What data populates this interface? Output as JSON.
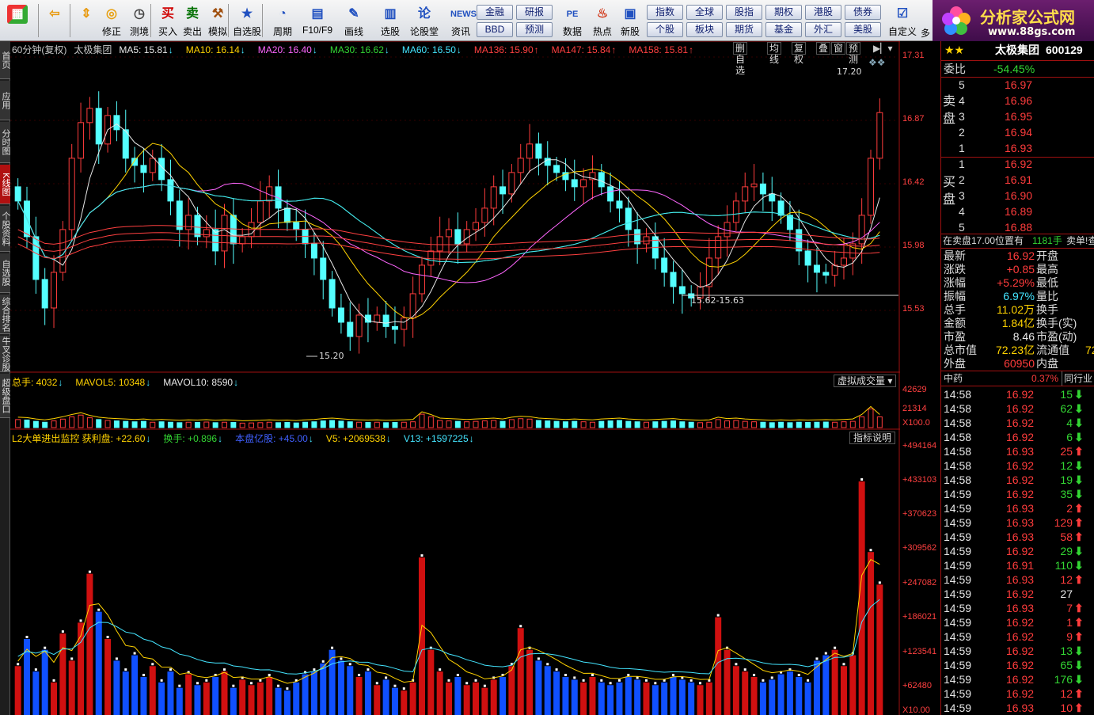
{
  "toolbar": {
    "items": [
      {
        "label": "",
        "icon": "grid-icon",
        "color": "#d03030"
      },
      {
        "label": "",
        "icon": "back-icon",
        "color": "#e89a10"
      },
      {
        "label": "",
        "icon": "updown-icon",
        "color": "#e89a10"
      },
      {
        "label": "修正",
        "icon": "refresh-icon",
        "color": "#e8a010"
      },
      {
        "label": "测境",
        "icon": "clock-icon",
        "color": "#444"
      },
      {
        "label": "买入",
        "icon": "买",
        "color": "#d00000"
      },
      {
        "label": "卖出",
        "icon": "卖",
        "color": "#007000"
      },
      {
        "label": "模拟",
        "icon": "hammer-icon",
        "color": "#a05010"
      },
      {
        "label": "自选股",
        "icon": "star-icon",
        "color": "#2050c0"
      },
      {
        "label": "周期",
        "icon": "cycle-icon",
        "color": "#2050c0"
      },
      {
        "label": "F10/F9",
        "icon": "f10-icon",
        "color": "#2050c0"
      },
      {
        "label": "画线",
        "icon": "pencil-icon",
        "color": "#2050c0"
      },
      {
        "label": "选股",
        "icon": "chart-icon",
        "color": "#2050c0"
      },
      {
        "label": "论股堂",
        "icon": "论",
        "color": "#2050c0"
      },
      {
        "label": "资讯",
        "icon": "NEWS",
        "color": "#2050c0"
      }
    ],
    "grid_a": [
      [
        "金融",
        "研报"
      ],
      [
        "BBD",
        "预测"
      ]
    ],
    "items2": [
      {
        "label": "数据",
        "icon": "PE",
        "color": "#2050c0"
      },
      {
        "label": "热点",
        "icon": "fire-icon",
        "color": "#d03010"
      },
      {
        "label": "新股",
        "icon": "doc-icon",
        "color": "#2050c0"
      }
    ],
    "grid_b": [
      [
        "指数",
        "全球",
        "股指",
        "期权",
        "港股",
        "债券"
      ],
      [
        "个股",
        "板块",
        "期货",
        "基金",
        "外汇",
        "美股"
      ]
    ],
    "custom_label": "自定义",
    "more_label": "多"
  },
  "logo": {
    "title": "分析家公式网",
    "url": "www.88gs.com"
  },
  "left_tabs": [
    {
      "label": "首页",
      "sel": false
    },
    {
      "label": "应用",
      "sel": false
    },
    {
      "label": "分时图",
      "sel": false
    },
    {
      "label": "K线图",
      "sel": true
    },
    {
      "label": "个股资料",
      "sel": false
    },
    {
      "label": "自选股",
      "sel": false
    },
    {
      "label": "综合排名",
      "sel": false
    },
    {
      "label": "牛叉诊股",
      "sel": false
    },
    {
      "label": "超级盘口",
      "sel": false
    }
  ],
  "kline": {
    "legend": [
      {
        "text": "60分钟(复权)",
        "color": "#c8c8c8"
      },
      {
        "text": "太极集团",
        "color": "#c8c8c8"
      },
      {
        "text": "MA5: 15.81",
        "arrow": "↓",
        "color": "#e8e8e8",
        "acolor": "#44e5ff"
      },
      {
        "text": "MA10: 16.14",
        "arrow": "↓",
        "color": "#ffd200",
        "acolor": "#44e5ff"
      },
      {
        "text": "MA20: 16.40",
        "arrow": "↓",
        "color": "#ff66ff",
        "acolor": "#44e5ff"
      },
      {
        "text": "MA30: 16.62",
        "arrow": "↓",
        "color": "#33d633",
        "acolor": "#44e5ff"
      },
      {
        "text": "MA60: 16.50",
        "arrow": "↓",
        "color": "#44e5ff",
        "acolor": "#44e5ff"
      },
      {
        "text": "MA136: 15.90",
        "arrow": "↑",
        "color": "#ff4040",
        "acolor": "#ff4040"
      },
      {
        "text": "MA147: 15.84",
        "arrow": "↑",
        "color": "#ff4040",
        "acolor": "#ff4040"
      },
      {
        "text": "MA158: 15.81",
        "arrow": "↑",
        "color": "#ff4040",
        "acolor": "#ff4040"
      }
    ],
    "option_buttons": [
      "删自选",
      "均线",
      "复权",
      "叠",
      "窗",
      "预测"
    ],
    "y_ticks": [
      "17.31",
      "16.87",
      "16.42",
      "15.98",
      "15.53"
    ],
    "high_label": "17.20",
    "low_label": "15.20",
    "range_label": "15.62-15.63"
  },
  "volume": {
    "legend": [
      {
        "text": "总手: 4032",
        "arrow": "↓",
        "color": "#ffd200"
      },
      {
        "text": "MAVOL5: 10348",
        "arrow": "↓",
        "color": "#ffd200"
      },
      {
        "text": "MAVOL10: 8590",
        "arrow": "↓",
        "color": "#e8e8e8"
      }
    ],
    "menu": "虚拟成交量",
    "y_ticks": [
      "42629",
      "21314",
      "X100.0"
    ]
  },
  "indicator": {
    "legend": [
      {
        "text": "L2大单进出监控 获利盘: +22.60",
        "arrow": "↓",
        "color": "#ffd200"
      },
      {
        "text": "换手: +0.896",
        "arrow": "↓",
        "color": "#33d633"
      },
      {
        "text": "本盘亿股: +45.00",
        "arrow": "↓",
        "color": "#4060ff"
      },
      {
        "text": "V5: +2069538",
        "arrow": "↓",
        "color": "#ffd200"
      },
      {
        "text": "V13: +1597225",
        "arrow": "↓",
        "color": "#44e5ff"
      }
    ],
    "help": "指标说明",
    "y_ticks": [
      "+494164",
      "+433103",
      "+370623",
      "+309562",
      "+247082",
      "+186021",
      "+123541",
      "+62480",
      "X10.00"
    ]
  },
  "right_panel": {
    "stars": "★★",
    "stock_name": "太极集团",
    "stock_code": "600129",
    "weibi_label": "委比",
    "weibi_value": "-54.45%",
    "sell_label": "卖盘",
    "buy_label": "买盘",
    "asks": [
      {
        "n": "5",
        "p": "16.97"
      },
      {
        "n": "4",
        "p": "16.96"
      },
      {
        "n": "3",
        "p": "16.95"
      },
      {
        "n": "2",
        "p": "16.94"
      },
      {
        "n": "1",
        "p": "16.93"
      }
    ],
    "bids": [
      {
        "n": "1",
        "p": "16.92"
      },
      {
        "n": "2",
        "p": "16.91"
      },
      {
        "n": "3",
        "p": "16.90"
      },
      {
        "n": "4",
        "p": "16.89"
      },
      {
        "n": "5",
        "p": "16.88"
      }
    ],
    "order_info": "在卖盘17.00位置有",
    "order_qty": "1181手",
    "order_more": "卖单!查",
    "stats": [
      {
        "l": "最新",
        "v": "16.92",
        "c": "red",
        "r": "开盘"
      },
      {
        "l": "涨跌",
        "v": "+0.85",
        "c": "red",
        "r": "最高"
      },
      {
        "l": "涨幅",
        "v": "+5.29%",
        "c": "red",
        "r": "最低"
      },
      {
        "l": "振幅",
        "v": "6.97%",
        "c": "cyan",
        "r": "量比"
      },
      {
        "l": "总手",
        "v": "11.02万",
        "c": "yel",
        "r": "换手"
      },
      {
        "l": "金额",
        "v": "1.84亿",
        "c": "yel",
        "r": "换手(实)"
      },
      {
        "l": "市盈",
        "v": "8.46",
        "c": "wht",
        "r": "市盈(动)"
      },
      {
        "l": "总市值",
        "v": "72.23亿",
        "c": "yel",
        "r": "流通值"
      },
      {
        "l": "外盘",
        "v": "60950",
        "c": "red",
        "r": "内盘"
      }
    ],
    "turnover_float": "72",
    "sector": "中药",
    "sector_change": "0.37%",
    "sector_more": "同行业",
    "ticks": [
      {
        "t": "14:58",
        "p": "16.92",
        "v": "15",
        "d": "down"
      },
      {
        "t": "14:58",
        "p": "16.92",
        "v": "62",
        "d": "down"
      },
      {
        "t": "14:58",
        "p": "16.92",
        "v": "4",
        "d": "down"
      },
      {
        "t": "14:58",
        "p": "16.92",
        "v": "6",
        "d": "down"
      },
      {
        "t": "14:58",
        "p": "16.93",
        "v": "25",
        "d": "up"
      },
      {
        "t": "14:58",
        "p": "16.92",
        "v": "12",
        "d": "down"
      },
      {
        "t": "14:58",
        "p": "16.92",
        "v": "19",
        "d": "down"
      },
      {
        "t": "14:59",
        "p": "16.92",
        "v": "35",
        "d": "down"
      },
      {
        "t": "14:59",
        "p": "16.93",
        "v": "2",
        "d": "up"
      },
      {
        "t": "14:59",
        "p": "16.93",
        "v": "129",
        "d": "up"
      },
      {
        "t": "14:59",
        "p": "16.93",
        "v": "58",
        "d": "up"
      },
      {
        "t": "14:59",
        "p": "16.92",
        "v": "29",
        "d": "down"
      },
      {
        "t": "14:59",
        "p": "16.91",
        "v": "110",
        "d": "down"
      },
      {
        "t": "14:59",
        "p": "16.93",
        "v": "12",
        "d": "up"
      },
      {
        "t": "14:59",
        "p": "16.92",
        "v": "27",
        "d": "none"
      },
      {
        "t": "14:59",
        "p": "16.93",
        "v": "7",
        "d": "up"
      },
      {
        "t": "14:59",
        "p": "16.92",
        "v": "1",
        "d": "up"
      },
      {
        "t": "14:59",
        "p": "16.92",
        "v": "9",
        "d": "up"
      },
      {
        "t": "14:59",
        "p": "16.92",
        "v": "13",
        "d": "down"
      },
      {
        "t": "14:59",
        "p": "16.92",
        "v": "65",
        "d": "down"
      },
      {
        "t": "14:59",
        "p": "16.92",
        "v": "176",
        "d": "down"
      },
      {
        "t": "14:59",
        "p": "16.92",
        "v": "12",
        "d": "up"
      },
      {
        "t": "14:59",
        "p": "16.93",
        "v": "10",
        "d": "up"
      }
    ]
  },
  "chart_data": [
    {
      "type": "candlestick",
      "title": "60分钟(复权) 太极集团",
      "ylim": [
        15.2,
        17.31
      ],
      "closes": [
        16.3,
        16.05,
        15.75,
        15.55,
        15.8,
        16.1,
        16.6,
        16.85,
        16.95,
        16.7,
        16.9,
        16.8,
        16.6,
        16.55,
        16.5,
        16.6,
        16.45,
        16.3,
        16.1,
        16.2,
        16.05,
        16.1,
        15.95,
        16.2,
        16.0,
        16.05,
        16.15,
        16.3,
        16.4,
        16.25,
        16.15,
        16.1,
        16.0,
        15.9,
        15.75,
        15.55,
        15.45,
        15.35,
        15.5,
        15.45,
        15.5,
        15.42,
        15.4,
        15.48,
        15.65,
        15.85,
        15.95,
        16.05,
        16.1,
        16.0,
        16.1,
        16.15,
        16.25,
        16.4,
        16.35,
        16.5,
        16.6,
        16.7,
        16.6,
        16.55,
        16.5,
        16.45,
        16.4,
        16.45,
        16.5,
        16.4,
        16.3,
        16.25,
        16.1,
        16.0,
        16.05,
        15.9,
        15.8,
        15.7,
        15.65,
        15.62,
        15.7,
        15.9,
        16.05,
        16.15,
        16.3,
        16.4,
        16.42,
        16.35,
        16.3,
        16.2,
        16.1,
        15.95,
        15.85,
        15.8,
        15.78,
        15.85,
        15.9,
        16.0,
        16.2,
        16.6,
        16.92
      ],
      "ma_series": [
        {
          "name": "MA5",
          "value": 15.81,
          "color": "#e8e8e8"
        },
        {
          "name": "MA10",
          "value": 16.14,
          "color": "#ffd200"
        },
        {
          "name": "MA20",
          "value": 16.4,
          "color": "#ff66ff"
        },
        {
          "name": "MA30",
          "value": 16.62,
          "color": "#33d633"
        },
        {
          "name": "MA60",
          "value": 16.5,
          "color": "#44e5ff"
        },
        {
          "name": "MA136",
          "value": 15.9,
          "color": "#ff4040"
        },
        {
          "name": "MA147",
          "value": 15.84,
          "color": "#ff4040"
        },
        {
          "name": "MA158",
          "value": 15.81,
          "color": "#ff4040"
        }
      ]
    },
    {
      "type": "bar",
      "title": "总手",
      "ylim": [
        0,
        42629
      ],
      "values": [
        9000,
        8500,
        7000,
        6000,
        7500,
        9500,
        12000,
        14000,
        11000,
        9000,
        8000,
        7500,
        7000,
        6500,
        7000,
        6000,
        6500,
        6000,
        5500,
        6000,
        5800,
        6200,
        5500,
        6000,
        5800,
        5000,
        5200,
        5500,
        6000,
        5500,
        5800,
        5200,
        6000,
        6500,
        7500,
        8000,
        7200,
        6500,
        6000,
        5800,
        6000,
        5500,
        5800,
        6000,
        6500,
        15000,
        12000,
        8000,
        7500,
        7000,
        6500,
        7000,
        7500,
        8000,
        7000,
        9000,
        10000,
        9500,
        8000,
        7500,
        7000,
        6500,
        7000,
        6500,
        6000,
        7000,
        7500,
        8000,
        7000,
        6500,
        6000,
        6500,
        7000,
        7500,
        6500,
        6000,
        5500,
        6000,
        9000,
        7500,
        8000,
        7000,
        6500,
        6000,
        5500,
        6000,
        5500,
        6000,
        5800,
        6000,
        6200,
        6000,
        6500,
        7000,
        12000,
        21000,
        12000
      ]
    },
    {
      "type": "bar",
      "title": "L2大单进出监控",
      "ylim": [
        0,
        494164
      ],
      "values": [
        90000,
        140000,
        80000,
        120000,
        60000,
        150000,
        100000,
        170000,
        260000,
        190000,
        140000,
        100000,
        80000,
        110000,
        70000,
        90000,
        60000,
        80000,
        50000,
        75000,
        55000,
        60000,
        70000,
        80000,
        50000,
        65000,
        55000,
        60000,
        70000,
        50000,
        45000,
        60000,
        75000,
        80000,
        95000,
        120000,
        100000,
        90000,
        70000,
        80000,
        55000,
        65000,
        50000,
        45000,
        60000,
        290000,
        120000,
        80000,
        60000,
        70000,
        55000,
        60000,
        50000,
        65000,
        70000,
        90000,
        160000,
        120000,
        100000,
        90000,
        80000,
        70000,
        65000,
        60000,
        70000,
        60000,
        55000,
        60000,
        70000,
        65000,
        60000,
        55000,
        60000,
        70000,
        65000,
        60000,
        55000,
        60000,
        180000,
        120000,
        90000,
        80000,
        70000,
        60000,
        65000,
        75000,
        80000,
        70000,
        60000,
        100000,
        110000,
        120000,
        90000,
        110000,
        430000,
        300000,
        240000
      ]
    }
  ]
}
